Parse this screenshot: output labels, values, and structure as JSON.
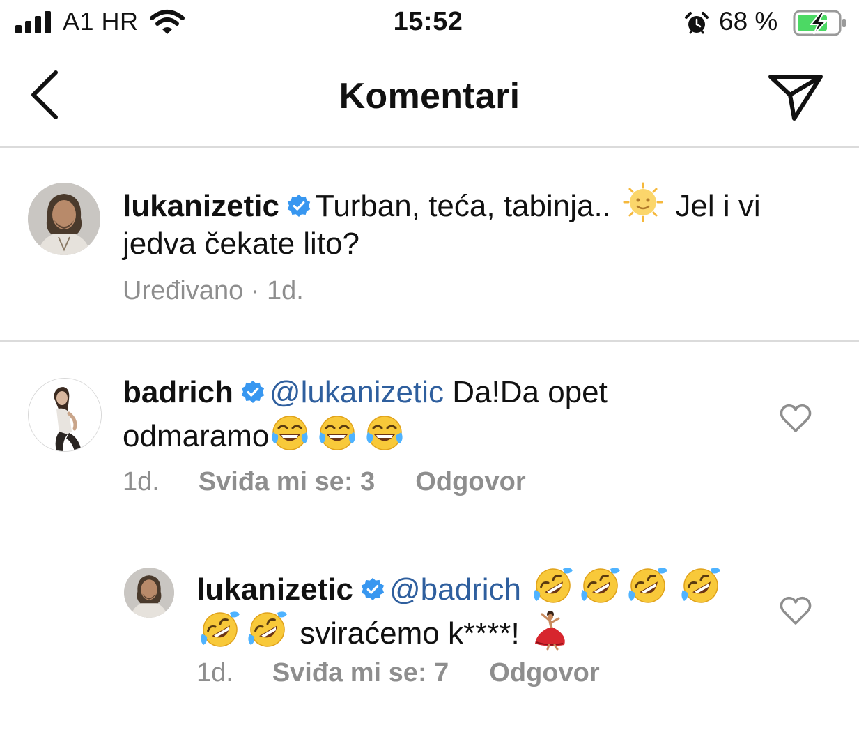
{
  "status_bar": {
    "carrier": "A1 HR",
    "time": "15:52",
    "battery_percent": "68 %",
    "icons": [
      "signal-icon",
      "wifi-icon",
      "alarm-icon",
      "battery-charging-icon"
    ]
  },
  "nav": {
    "title": "Komentari",
    "icons": [
      "chevron-left-icon",
      "paper-plane-icon"
    ]
  },
  "caption": {
    "username": "lukanizetic",
    "text_before_emoji": "Turban, teća, tabinja..",
    "emoji": "sun-face-emoji",
    "text_after_emoji": "Jel i vi jedva čekate lito?",
    "meta": "Uređivano · 1d."
  },
  "comments": [
    {
      "username": "badrich",
      "mention": "@lukanizetic",
      "text": "Da!Da opet odmaramo",
      "emojis": [
        "joy-emoji",
        "joy-emoji",
        "joy-emoji"
      ],
      "time": "1d.",
      "likes": "Sviđa mi se: 3",
      "reply": "Odgovor"
    },
    {
      "username": "lukanizetic",
      "mention": "@badrich",
      "emojis_before": [
        "rofl-emoji",
        "rofl-emoji",
        "rofl-emoji",
        "rofl-emoji",
        "rofl-emoji",
        "rofl-emoji"
      ],
      "text": "sviraćemo k****!",
      "emoji_after": "dancer-emoji",
      "time": "1d.",
      "likes": "Sviđa mi se: 7",
      "reply": "Odgovor"
    }
  ],
  "colors": {
    "verified_blue": "#3897f0",
    "mention_blue": "#2f5f9e",
    "meta_gray": "#8e8e8e",
    "divider": "#dbdbdb",
    "battery_green": "#4cd964"
  }
}
